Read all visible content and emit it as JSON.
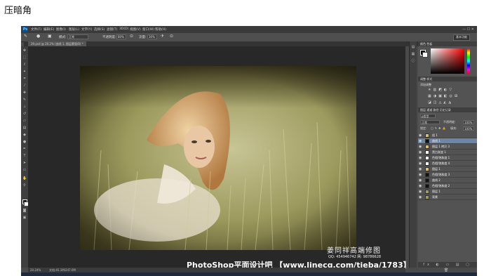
{
  "page_title": "压暗角",
  "ps": {
    "logo": "Ps",
    "menu": [
      "文件(F)",
      "编辑(E)",
      "图像(I)",
      "图层(L)",
      "文字(Y)",
      "选择(S)",
      "滤镜(T)",
      "3D(D)",
      "视图(V)",
      "窗口(W)",
      "帮助(H)"
    ],
    "window_buttons": "— ☐ ✕",
    "options": {
      "mode_label": "模式:",
      "mode_value": "正常",
      "opacity_label": "不透明度:",
      "opacity_value": "80%",
      "flow_label": "流量:",
      "flow_value": "30%",
      "workspace": "基本功能"
    },
    "doc_tab": "29.psd @ 20.2% (曲线 1, 图层蒙版/8) *",
    "status": {
      "zoom": "20.24%",
      "doc": "文档:45.1M/247.6M"
    },
    "watermark": {
      "author": "姜同祥高端修图",
      "contact": "QQ: 454946742   网: 98786628",
      "site": "PhotoShop平面设计吧 【www.linecg.com/tieba/1783】"
    },
    "panels": {
      "color_tab": "颜色 色板",
      "adjust_tab": "调整 样式",
      "adjust_title": "添加调整",
      "layers_tab": "图层 通道 路径 历史记录",
      "kind": "ρ类型",
      "blend": "正常",
      "opacity_label": "不透明度:",
      "opacity_value": "100%",
      "lock_label": "锁定:",
      "fill_label": "填充:",
      "fill_value": "100%",
      "bottom_icons": "fx ◐ ▭ ▤ ▢ 🗑"
    },
    "layers": [
      {
        "name": "组 1",
        "thumb": "folder"
      },
      {
        "name": "曲线 1",
        "thumb": "mask-black",
        "selected": true
      },
      {
        "name": "图层 1 拷贝 3",
        "thumb": "folder"
      },
      {
        "name": "黑白渐变 1",
        "thumb": "white"
      },
      {
        "name": "色相/饱和度 1",
        "thumb": "white"
      },
      {
        "name": "色相/饱和度 4",
        "thumb": "white"
      },
      {
        "name": "图层 1",
        "thumb": "folder"
      },
      {
        "name": "色相/饱和度 3",
        "thumb": "black"
      },
      {
        "name": "曲线 2",
        "thumb": "black"
      },
      {
        "name": "色相/饱和度 2",
        "thumb": "black"
      },
      {
        "name": "图层 1",
        "thumb": "photo"
      },
      {
        "name": "背景",
        "thumb": "photo"
      }
    ]
  }
}
